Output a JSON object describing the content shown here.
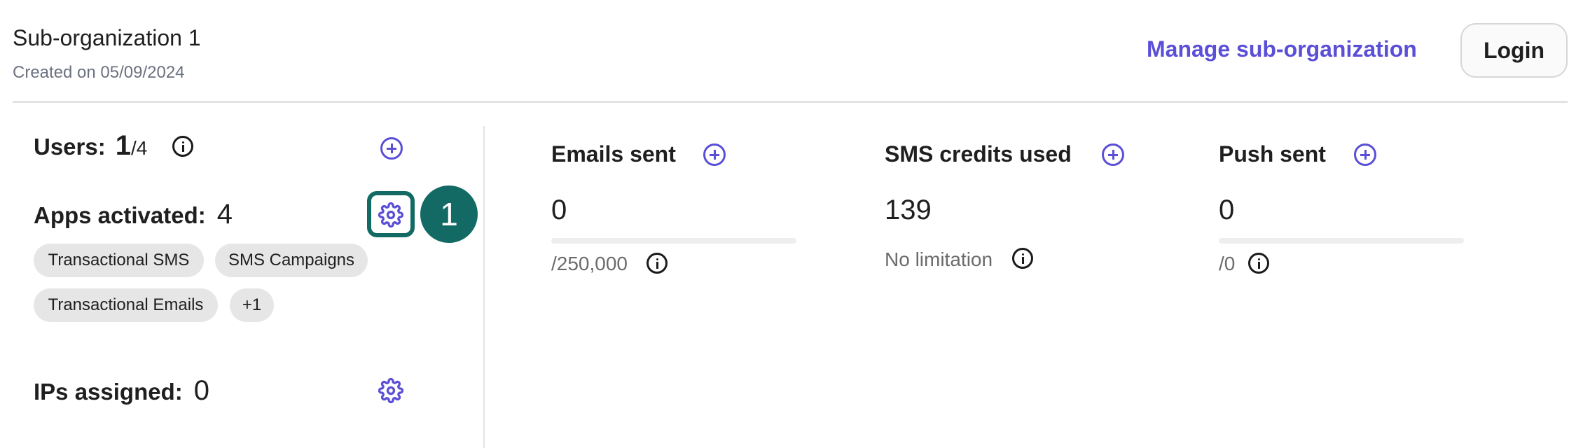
{
  "header": {
    "title": "Sub-organization 1",
    "created": "Created on 05/09/2024",
    "manage_label": "Manage sub-organization",
    "login_label": "Login"
  },
  "left": {
    "users_label": "Users:",
    "users_count": "1",
    "users_max": "/4",
    "apps_label": "Apps activated:",
    "apps_count": "4",
    "apps": [
      "Transactional SMS",
      "SMS Campaigns",
      "Transactional Emails",
      "+1"
    ],
    "ips_label": "IPs assigned:",
    "ips_count": "0",
    "step_badge": "1"
  },
  "metrics": [
    {
      "title": "Emails sent",
      "value": "0",
      "limit": "/250,000",
      "progress": 0
    },
    {
      "title": "SMS credits used",
      "value": "139",
      "limit": "No limitation"
    },
    {
      "title": "Push sent",
      "value": "0",
      "limit": "/0",
      "progress": 0
    }
  ],
  "colors": {
    "accent": "#5a4fd6",
    "highlight": "#136a65"
  },
  "icons": [
    "info-icon",
    "add-circle-icon",
    "gear-icon"
  ]
}
